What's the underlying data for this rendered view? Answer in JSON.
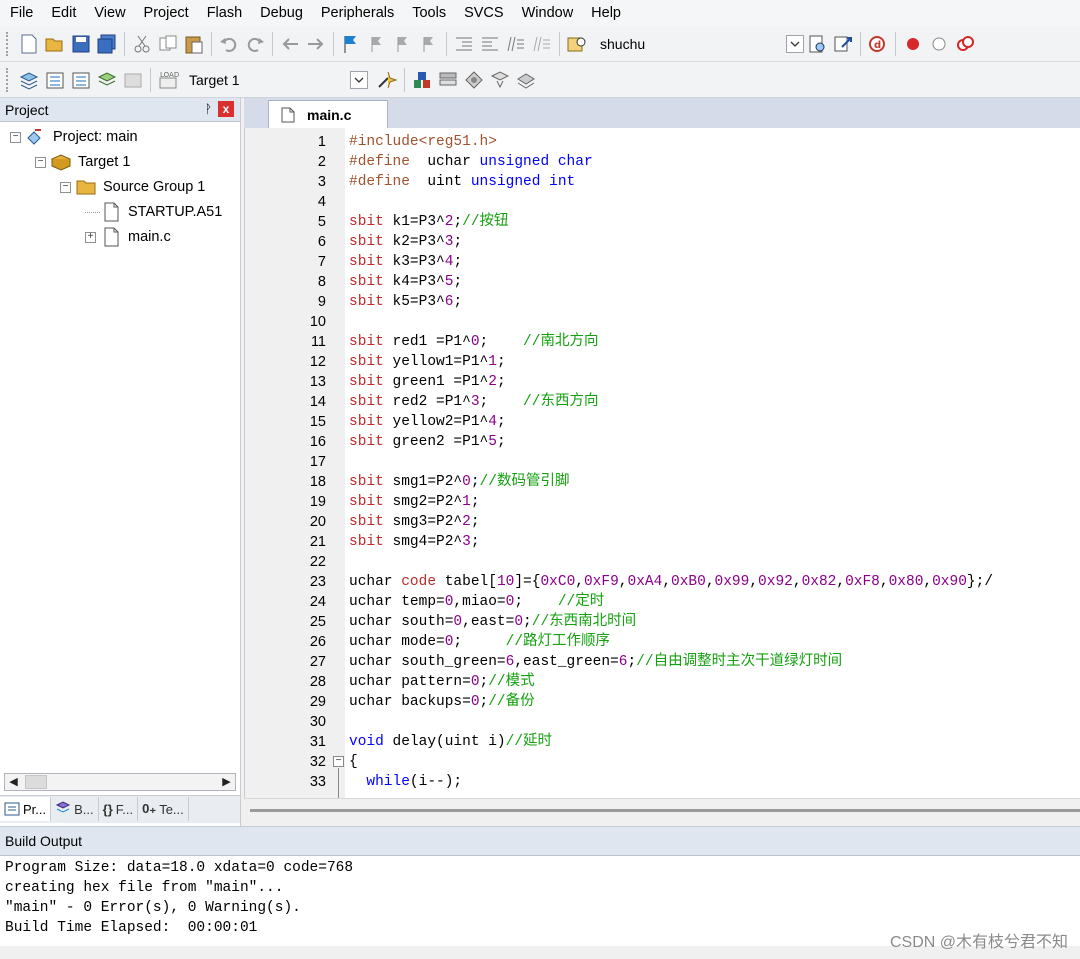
{
  "menu": [
    "File",
    "Edit",
    "View",
    "Project",
    "Flash",
    "Debug",
    "Peripherals",
    "Tools",
    "SVCS",
    "Window",
    "Help"
  ],
  "toolbar1": {
    "icons": [
      "new-file-icon",
      "open-folder-icon",
      "save-icon",
      "save-all-icon",
      "cut-icon",
      "copy-icon",
      "paste-icon",
      "undo-icon",
      "redo-icon",
      "nav-back-icon",
      "nav-forward-icon",
      "bookmark-icon",
      "bookmark-prev-icon",
      "bookmark-next-icon",
      "bookmark-clear-icon",
      "indent-icon",
      "unindent-icon",
      "comment-icon",
      "uncomment-icon",
      "find-in-files-icon"
    ],
    "find_value": "shuchu",
    "right_icons": [
      "find-icon",
      "incremental-find-icon",
      "debug-session-icon",
      "breakpoint-icon",
      "disable-breakpoint-icon",
      "kill-breakpoints-icon"
    ]
  },
  "toolbar2": {
    "icons": [
      "translate-icon",
      "build-icon",
      "rebuild-icon",
      "batch-build-icon",
      "stop-build-icon",
      "download-icon"
    ],
    "download_label": "LOAD",
    "target_value": "Target 1",
    "right_icons": [
      "target-options-icon",
      "file-extensions-icon",
      "manage-components-icon",
      "select-packs-icon",
      "pack-installer-icon",
      "run-time-environment-icon"
    ]
  },
  "project_panel": {
    "title": "Project",
    "pin": "ᚹ",
    "close": "x",
    "tree": [
      {
        "label": "Project: main",
        "level": 0,
        "expander": "⊟",
        "icon": "project-icon"
      },
      {
        "label": "Target 1",
        "level": 1,
        "expander": "⊟",
        "icon": "target-icon"
      },
      {
        "label": "Source Group 1",
        "level": 2,
        "expander": "⊟",
        "icon": "folder-icon"
      },
      {
        "label": "STARTUP.A51",
        "level": 3,
        "expander": "",
        "icon": "file-icon"
      },
      {
        "label": "main.c",
        "level": 3,
        "expander": "⊞",
        "icon": "file-icon"
      }
    ],
    "tabs": [
      {
        "label": "Pr...",
        "icon": "project-tab-icon"
      },
      {
        "label": "B...",
        "icon": "books-tab-icon"
      },
      {
        "label": "F...",
        "icon": "functions-tab-icon",
        "glyph": "{}"
      },
      {
        "label": "Te...",
        "icon": "templates-tab-icon",
        "glyph": "0₊"
      }
    ]
  },
  "editor": {
    "tab_label": "main.c",
    "lines": [
      {
        "n": "1",
        "parts": [
          [
            "pp",
            "#include<reg51.h>"
          ]
        ]
      },
      {
        "n": "2",
        "parts": [
          [
            "pp",
            "#define"
          ],
          [
            "",
            "  uchar "
          ],
          [
            "kw",
            "unsigned char"
          ]
        ]
      },
      {
        "n": "3",
        "parts": [
          [
            "pp",
            "#define"
          ],
          [
            "",
            "  uint "
          ],
          [
            "kw",
            "unsigned int"
          ]
        ]
      },
      {
        "n": "4",
        "parts": []
      },
      {
        "n": "5",
        "parts": [
          [
            "sb",
            "sbit"
          ],
          [
            "",
            " k1=P3^"
          ],
          [
            "num",
            "2"
          ],
          [
            "",
            ";"
          ],
          [
            "cm",
            "//按钮"
          ]
        ]
      },
      {
        "n": "6",
        "parts": [
          [
            "sb",
            "sbit"
          ],
          [
            "",
            " k2=P3^"
          ],
          [
            "num",
            "3"
          ],
          [
            "",
            ";"
          ]
        ]
      },
      {
        "n": "7",
        "parts": [
          [
            "sb",
            "sbit"
          ],
          [
            "",
            " k3=P3^"
          ],
          [
            "num",
            "4"
          ],
          [
            "",
            ";"
          ]
        ]
      },
      {
        "n": "8",
        "parts": [
          [
            "sb",
            "sbit"
          ],
          [
            "",
            " k4=P3^"
          ],
          [
            "num",
            "5"
          ],
          [
            "",
            ";"
          ]
        ]
      },
      {
        "n": "9",
        "parts": [
          [
            "sb",
            "sbit"
          ],
          [
            "",
            " k5=P3^"
          ],
          [
            "num",
            "6"
          ],
          [
            "",
            ";"
          ]
        ]
      },
      {
        "n": "10",
        "parts": []
      },
      {
        "n": "11",
        "parts": [
          [
            "sb",
            "sbit"
          ],
          [
            "",
            " red1 =P1^"
          ],
          [
            "num",
            "0"
          ],
          [
            "",
            ";    "
          ],
          [
            "cm",
            "//南北方向"
          ]
        ]
      },
      {
        "n": "12",
        "parts": [
          [
            "sb",
            "sbit"
          ],
          [
            "",
            " yellow1=P1^"
          ],
          [
            "num",
            "1"
          ],
          [
            "",
            ";"
          ]
        ]
      },
      {
        "n": "13",
        "parts": [
          [
            "sb",
            "sbit"
          ],
          [
            "",
            " green1 =P1^"
          ],
          [
            "num",
            "2"
          ],
          [
            "",
            ";"
          ]
        ]
      },
      {
        "n": "14",
        "parts": [
          [
            "sb",
            "sbit"
          ],
          [
            "",
            " red2 =P1^"
          ],
          [
            "num",
            "3"
          ],
          [
            "",
            ";    "
          ],
          [
            "cm",
            "//东西方向"
          ]
        ]
      },
      {
        "n": "15",
        "parts": [
          [
            "sb",
            "sbit"
          ],
          [
            "",
            " yellow2=P1^"
          ],
          [
            "num",
            "4"
          ],
          [
            "",
            ";"
          ]
        ]
      },
      {
        "n": "16",
        "parts": [
          [
            "sb",
            "sbit"
          ],
          [
            "",
            " green2 =P1^"
          ],
          [
            "num",
            "5"
          ],
          [
            "",
            ";"
          ]
        ]
      },
      {
        "n": "17",
        "parts": []
      },
      {
        "n": "18",
        "parts": [
          [
            "sb",
            "sbit"
          ],
          [
            "",
            " smg1=P2^"
          ],
          [
            "num",
            "0"
          ],
          [
            "",
            ";"
          ],
          [
            "cm",
            "//数码管引脚"
          ]
        ]
      },
      {
        "n": "19",
        "parts": [
          [
            "sb",
            "sbit"
          ],
          [
            "",
            " smg2=P2^"
          ],
          [
            "num",
            "1"
          ],
          [
            "",
            ";"
          ]
        ]
      },
      {
        "n": "20",
        "parts": [
          [
            "sb",
            "sbit"
          ],
          [
            "",
            " smg3=P2^"
          ],
          [
            "num",
            "2"
          ],
          [
            "",
            ";"
          ]
        ]
      },
      {
        "n": "21",
        "parts": [
          [
            "sb",
            "sbit"
          ],
          [
            "",
            " smg4=P2^"
          ],
          [
            "num",
            "3"
          ],
          [
            "",
            ";"
          ]
        ]
      },
      {
        "n": "22",
        "parts": []
      },
      {
        "n": "23",
        "parts": [
          [
            "",
            "uchar "
          ],
          [
            "sb",
            "code"
          ],
          [
            "",
            " tabel["
          ],
          [
            "num",
            "10"
          ],
          [
            "",
            "]={"
          ],
          [
            "num",
            "0xC0"
          ],
          [
            "",
            ","
          ],
          [
            "num",
            "0xF9"
          ],
          [
            "",
            ","
          ],
          [
            "num",
            "0xA4"
          ],
          [
            "",
            ","
          ],
          [
            "num",
            "0xB0"
          ],
          [
            "",
            ","
          ],
          [
            "num",
            "0x99"
          ],
          [
            "",
            ","
          ],
          [
            "num",
            "0x92"
          ],
          [
            "",
            ","
          ],
          [
            "num",
            "0x82"
          ],
          [
            "",
            ","
          ],
          [
            "num",
            "0xF8"
          ],
          [
            "",
            ","
          ],
          [
            "num",
            "0x80"
          ],
          [
            "",
            ","
          ],
          [
            "num",
            "0x90"
          ],
          [
            "",
            "};/"
          ]
        ]
      },
      {
        "n": "24",
        "parts": [
          [
            "",
            "uchar temp="
          ],
          [
            "num",
            "0"
          ],
          [
            "",
            ",miao="
          ],
          [
            "num",
            "0"
          ],
          [
            "",
            ";    "
          ],
          [
            "cm",
            "//定时"
          ]
        ]
      },
      {
        "n": "25",
        "parts": [
          [
            "",
            "uchar south="
          ],
          [
            "num",
            "0"
          ],
          [
            "",
            ",east="
          ],
          [
            "num",
            "0"
          ],
          [
            "",
            ";"
          ],
          [
            "cm",
            "//东西南北时间"
          ]
        ]
      },
      {
        "n": "26",
        "parts": [
          [
            "",
            "uchar mode="
          ],
          [
            "num",
            "0"
          ],
          [
            "",
            ";     "
          ],
          [
            "cm",
            "//路灯工作顺序"
          ]
        ]
      },
      {
        "n": "27",
        "parts": [
          [
            "",
            "uchar south_green="
          ],
          [
            "num",
            "6"
          ],
          [
            "",
            ",east_green="
          ],
          [
            "num",
            "6"
          ],
          [
            "",
            ";"
          ],
          [
            "cm",
            "//自由调整时主次干道绿灯时间"
          ]
        ]
      },
      {
        "n": "28",
        "parts": [
          [
            "",
            "uchar pattern="
          ],
          [
            "num",
            "0"
          ],
          [
            "",
            ";"
          ],
          [
            "cm",
            "//模式"
          ]
        ]
      },
      {
        "n": "29",
        "parts": [
          [
            "",
            "uchar backups="
          ],
          [
            "num",
            "0"
          ],
          [
            "",
            ";"
          ],
          [
            "cm",
            "//备份"
          ]
        ]
      },
      {
        "n": "30",
        "parts": []
      },
      {
        "n": "31",
        "parts": [
          [
            "kw",
            "void"
          ],
          [
            "",
            " delay(uint i)"
          ],
          [
            "cm",
            "//延时"
          ]
        ]
      },
      {
        "n": "32",
        "parts": [
          [
            "",
            "{"
          ]
        ],
        "fold": "⊟"
      },
      {
        "n": "33",
        "parts": [
          [
            "",
            "  "
          ],
          [
            "kw",
            "while"
          ],
          [
            "",
            "(i--);"
          ]
        ]
      }
    ]
  },
  "build_output": {
    "title": "Build Output",
    "lines": [
      "Program Size: data=18.0 xdata=0 code=768",
      "creating hex file from \"main\"...",
      "\"main\" - 0 Error(s), 0 Warning(s).",
      "Build Time Elapsed:  00:00:01"
    ]
  },
  "watermark": "CSDN @木有枝兮君不知"
}
